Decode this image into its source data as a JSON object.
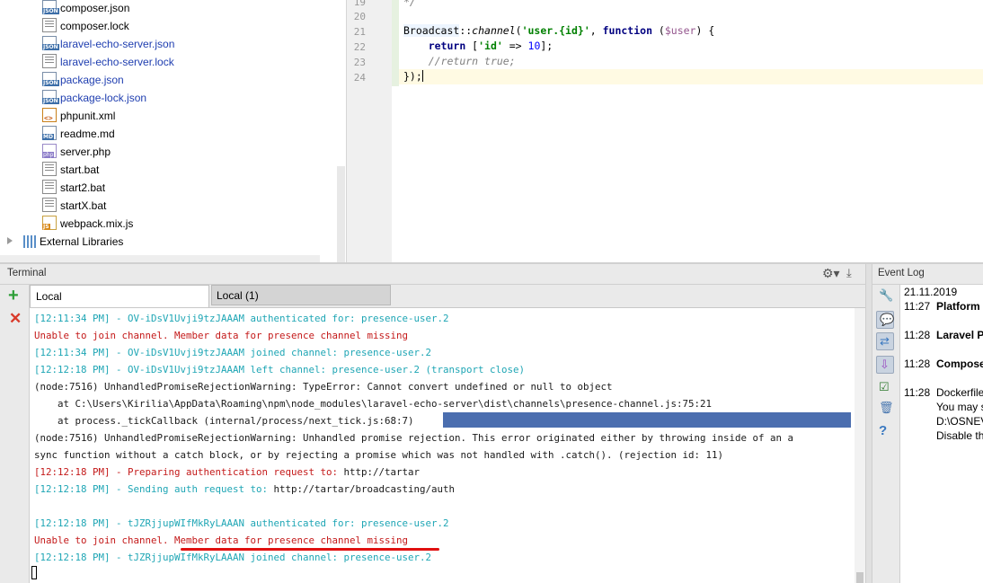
{
  "project_tree": {
    "items": [
      {
        "label": "composer.json",
        "icon": "json-file-icon"
      },
      {
        "label": "composer.lock",
        "icon": "text-file-icon"
      },
      {
        "label": "laravel-echo-server.json",
        "icon": "json-file-icon"
      },
      {
        "label": "laravel-echo-server.lock",
        "icon": "text-file-icon"
      },
      {
        "label": "package.json",
        "icon": "json-file-icon"
      },
      {
        "label": "package-lock.json",
        "icon": "json-file-icon"
      },
      {
        "label": "phpunit.xml",
        "icon": "xml-file-icon"
      },
      {
        "label": "readme.md",
        "icon": "markdown-file-icon"
      },
      {
        "label": "server.php",
        "icon": "php-file-icon"
      },
      {
        "label": "start.bat",
        "icon": "text-file-icon"
      },
      {
        "label": "start2.bat",
        "icon": "text-file-icon"
      },
      {
        "label": "startX.bat",
        "icon": "text-file-icon"
      },
      {
        "label": "webpack.mix.js",
        "icon": "js-file-icon"
      }
    ],
    "external_libraries": "External Libraries"
  },
  "editor": {
    "line_numbers": [
      "19",
      "20",
      "21",
      "22",
      "23",
      "24"
    ],
    "line19": "*/",
    "l21_class": "Broadcast",
    "l21_sep": "::",
    "l21_method": "channel",
    "l21_open": "(",
    "l21_str": "'user.{id}'",
    "l21_comma": ", ",
    "l21_function": "function",
    "l21_paren": " (",
    "l21_var": "$user",
    "l21_close": ") {",
    "l22_indent": "    ",
    "l22_return": "return",
    "l22_open": " [",
    "l22_key": "'id'",
    "l22_arrow": " => ",
    "l22_num": "10",
    "l22_close": "];",
    "l23_indent": "    ",
    "l23_comment": "//return true;",
    "line24": "});"
  },
  "terminal": {
    "title": "Terminal",
    "tabs": [
      "Local",
      "Local (1)"
    ],
    "lines": [
      {
        "text": "[12:11:34 PM] - OV-iDsV1Uvji9tzJAAAM authenticated for: presence-user.2",
        "color": "cyan"
      },
      {
        "text": "Unable to join channel. Member data for presence channel missing",
        "color": "red"
      },
      {
        "text": "[12:11:34 PM] - OV-iDsV1Uvji9tzJAAAM joined channel: presence-user.2",
        "color": "cyan"
      },
      {
        "text": "[12:12:18 PM] - OV-iDsV1Uvji9tzJAAAM left channel: presence-user.2 (transport close)",
        "color": "cyan"
      },
      {
        "text": "(node:7516) UnhandledPromiseRejectionWarning: TypeError: Cannot convert undefined or null to object",
        "color": "default"
      },
      {
        "text": "    at C:\\Users\\Kirilia\\AppData\\Roaming\\npm\\node_modules\\laravel-echo-server\\dist\\channels\\presence-channel.js:75:21",
        "color": "default"
      },
      {
        "text": "    at process._tickCallback (internal/process/next_tick.js:68:7)",
        "color": "default"
      },
      {
        "text": "(node:7516) UnhandledPromiseRejectionWarning: Unhandled promise rejection. This error originated either by throwing inside of an a",
        "color": "default"
      },
      {
        "text": "sync function without a catch block, or by rejecting a promise which was not handled with .catch(). (rejection id: 11)",
        "color": "default"
      },
      {
        "text": "[12:12:18 PM] - Preparing authentication request to: http://tartar",
        "color": "red-mixed",
        "prefix": "[12:12:18 PM] - Preparing authentication request to: ",
        "suffix": "http://tartar"
      },
      {
        "text": "[12:12:18 PM] - Sending auth request to: http://tartar/broadcasting/auth",
        "color": "cyan-mixed",
        "prefix": "[12:12:18 PM] - Sending auth request to: ",
        "suffix": "http://tartar/broadcasting/auth"
      },
      {
        "text": "",
        "color": "default"
      },
      {
        "text": "[12:12:18 PM] - tJZRjjupWIfMkRyLAAAN authenticated for: presence-user.2",
        "color": "cyan"
      },
      {
        "text": "Unable to join channel. Member data for presence channel missing",
        "color": "red"
      },
      {
        "text": "[12:12:18 PM] - tJZRjjupWIfMkRyLAAAN joined channel: presence-user.2",
        "color": "cyan"
      }
    ]
  },
  "event_log": {
    "title": "Event Log",
    "date": "21.11.2019",
    "entries": [
      {
        "time": "11:27",
        "message": "Platform",
        "bold": true
      },
      {
        "time": "11:28",
        "message": "Laravel Pl",
        "bold": true
      },
      {
        "time": "11:28",
        "message": "Compose",
        "bold": true
      },
      {
        "time": "11:28",
        "message": "Dockerfile",
        "bold": false
      }
    ],
    "extra_lines": [
      "You may s",
      "D:\\OSNEV",
      "Disable th"
    ]
  },
  "colors": {
    "terminal_cyan": "#1fa6b5",
    "terminal_red": "#c41a1a",
    "selection": "#4b6eaf",
    "vcs_modified": "#1f3eb0"
  }
}
